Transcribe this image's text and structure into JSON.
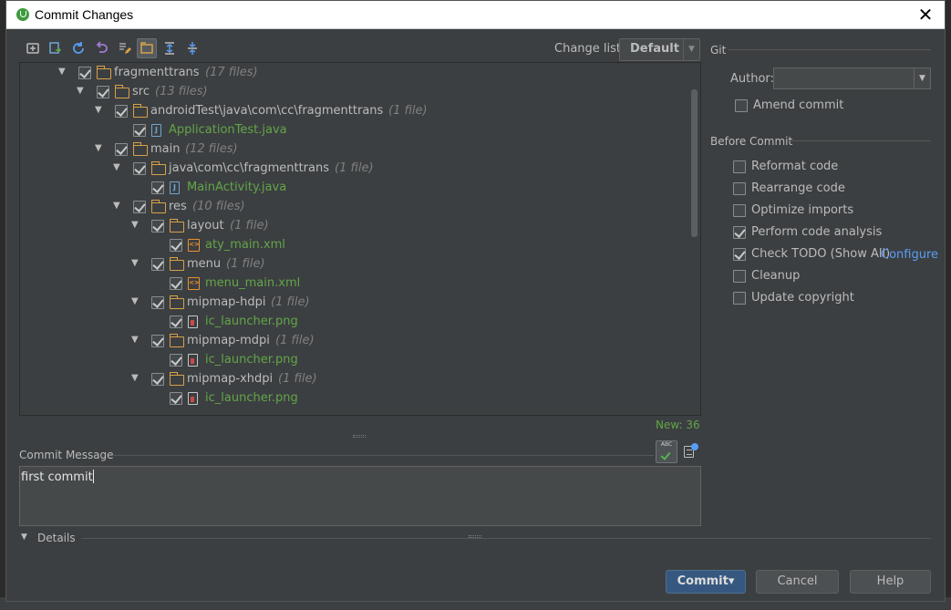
{
  "window": {
    "title": "Commit Changes",
    "close_glyph": "✕"
  },
  "toolbar": {
    "icons": [
      "show-diff-icon",
      "move-to-changelist-icon",
      "refresh-icon",
      "rollback-icon",
      "edit-source-icon",
      "group-by-directory-icon",
      "expand-all-icon",
      "collapse-all-icon"
    ],
    "change_list_label": "Change list:",
    "change_list_value": "Default"
  },
  "tree": {
    "rows": [
      {
        "depth": 2,
        "name": "fragmenttrans",
        "count": "(17 files)",
        "type": "folder"
      },
      {
        "depth": 3,
        "name": "src",
        "count": "(13 files)",
        "type": "folder"
      },
      {
        "depth": 4,
        "name": "androidTest\\java\\com\\cc\\fragmenttrans",
        "count": "(1 file)",
        "type": "folder"
      },
      {
        "depth": 5,
        "name": "ApplicationTest.java",
        "count": "",
        "type": "java"
      },
      {
        "depth": 4,
        "name": "main",
        "count": "(12 files)",
        "type": "folder"
      },
      {
        "depth": 5,
        "name": "java\\com\\cc\\fragmenttrans",
        "count": "(1 file)",
        "type": "folder"
      },
      {
        "depth": 6,
        "name": "MainActivity.java",
        "count": "",
        "type": "java"
      },
      {
        "depth": 5,
        "name": "res",
        "count": "(10 files)",
        "type": "folder"
      },
      {
        "depth": 6,
        "name": "layout",
        "count": "(1 file)",
        "type": "folder"
      },
      {
        "depth": 7,
        "name": "aty_main.xml",
        "count": "",
        "type": "xml"
      },
      {
        "depth": 6,
        "name": "menu",
        "count": "(1 file)",
        "type": "folder"
      },
      {
        "depth": 7,
        "name": "menu_main.xml",
        "count": "",
        "type": "xml"
      },
      {
        "depth": 6,
        "name": "mipmap-hdpi",
        "count": "(1 file)",
        "type": "folder"
      },
      {
        "depth": 7,
        "name": "ic_launcher.png",
        "count": "",
        "type": "png"
      },
      {
        "depth": 6,
        "name": "mipmap-mdpi",
        "count": "(1 file)",
        "type": "folder"
      },
      {
        "depth": 7,
        "name": "ic_launcher.png",
        "count": "",
        "type": "png"
      },
      {
        "depth": 6,
        "name": "mipmap-xhdpi",
        "count": "(1 file)",
        "type": "folder"
      },
      {
        "depth": 7,
        "name": "ic_launcher.png",
        "count": "",
        "type": "png"
      }
    ],
    "new_count": "New: 36"
  },
  "commit_message": {
    "label": "Commit Message",
    "value": "first commit",
    "spell_check_text": "ABC"
  },
  "details": {
    "label": "Details"
  },
  "git": {
    "section_title": "Git",
    "author_label": "Author:",
    "author_value": "",
    "amend_label": "Amend commit",
    "amend_checked": false
  },
  "before_commit": {
    "section_title": "Before Commit",
    "options": [
      {
        "label": "Reformat code",
        "checked": false
      },
      {
        "label": "Rearrange code",
        "checked": false
      },
      {
        "label": "Optimize imports",
        "checked": false
      },
      {
        "label": "Perform code analysis",
        "checked": true
      },
      {
        "label": "Check TODO (Show All)",
        "checked": true
      },
      {
        "label": "Cleanup",
        "checked": false
      },
      {
        "label": "Update copyright",
        "checked": false
      }
    ],
    "configure_link": "Configure"
  },
  "buttons": {
    "commit": "Commit▾",
    "cancel": "Cancel",
    "help": "Help"
  },
  "colors": {
    "dialog_bg": "#3c3f41",
    "new_file_green": "#62a548",
    "link_blue": "#589df6",
    "primary_button": "#365880"
  }
}
